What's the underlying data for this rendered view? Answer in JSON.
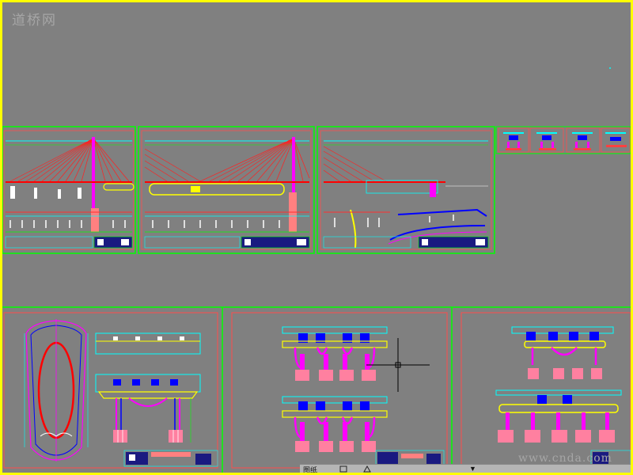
{
  "watermark": {
    "top": "道桥网",
    "bottom": "www.cnda.com"
  },
  "status_bar": {
    "left_text": "图纸",
    "dropdown_glyph": "▼"
  },
  "colors": {
    "canvas": "#808080",
    "frame": "#ffff00",
    "sheet_border": "#00ff00",
    "sheet_border_inner": "#ff4d4d",
    "cable": "#ff0000",
    "deck": "#00ffff",
    "pier": "#ff00ff",
    "girder": "#0000ff",
    "crosshair": "#000000"
  },
  "icons": [
    "crosshair-cursor-icon",
    "view-cube-icon",
    "layout-icon"
  ]
}
